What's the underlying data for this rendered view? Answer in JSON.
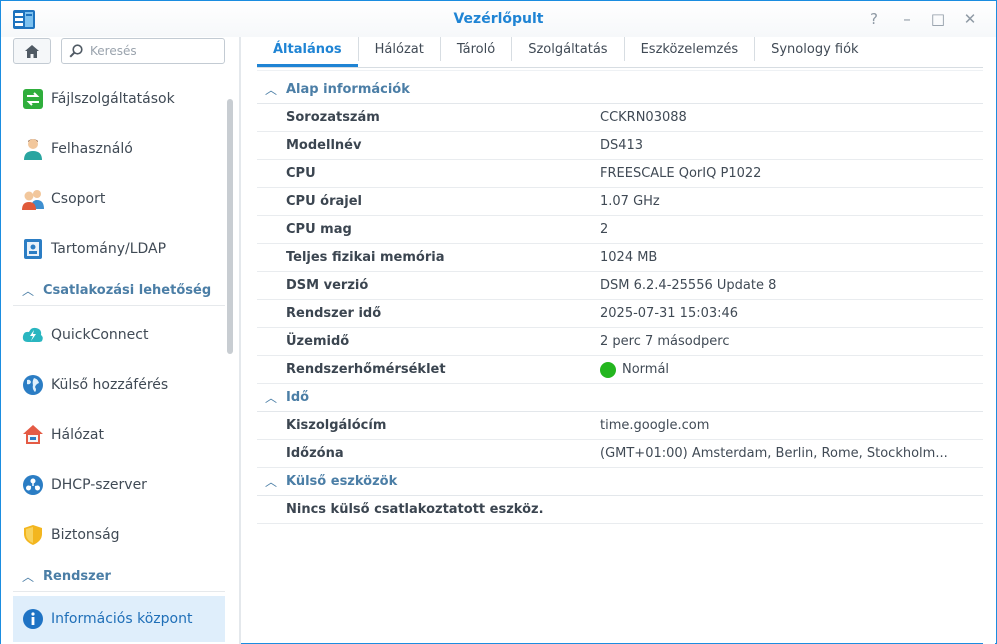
{
  "window": {
    "title": "Vezérlőpult",
    "controls": {
      "help": "?",
      "minimize": "–",
      "maximize": "□",
      "close": "✕"
    }
  },
  "search": {
    "placeholder": "Keresés",
    "value": ""
  },
  "sidebar": {
    "items_top": [
      {
        "label": "Fájlszolgáltatások",
        "icon": "file-services-icon"
      },
      {
        "label": "Felhasználó",
        "icon": "user-icon"
      },
      {
        "label": "Csoport",
        "icon": "group-icon"
      },
      {
        "label": "Tartomány/LDAP",
        "icon": "domain-ldap-icon"
      }
    ],
    "group_connectivity": "Csatlakozási lehetőség",
    "items_connectivity": [
      {
        "label": "QuickConnect",
        "icon": "quickconnect-icon"
      },
      {
        "label": "Külső hozzáférés",
        "icon": "external-access-icon"
      },
      {
        "label": "Hálózat",
        "icon": "network-icon"
      },
      {
        "label": "DHCP-szerver",
        "icon": "dhcp-server-icon"
      },
      {
        "label": "Biztonság",
        "icon": "security-icon"
      }
    ],
    "group_system": "Rendszer",
    "items_system": [
      {
        "label": "Információs központ",
        "icon": "info-center-icon",
        "active": true
      }
    ]
  },
  "tabs": [
    "Általános",
    "Hálózat",
    "Tároló",
    "Szolgáltatás",
    "Eszközelemzés",
    "Synology fiók"
  ],
  "active_tab": "Általános",
  "sections": {
    "basic": {
      "title": "Alap információk",
      "rows": [
        {
          "key": "Sorozatszám",
          "value": "CCKRN03088"
        },
        {
          "key": "Modellnév",
          "value": "DS413"
        },
        {
          "key": "CPU",
          "value": "FREESCALE QorIQ P1022"
        },
        {
          "key": "CPU órajel",
          "value": "1.07 GHz"
        },
        {
          "key": "CPU mag",
          "value": "2"
        },
        {
          "key": "Teljes fizikai memória",
          "value": "1024 MB"
        },
        {
          "key": "DSM verzió",
          "value": "DSM 6.2.4-25556 Update 8"
        },
        {
          "key": "Rendszer idő",
          "value": "2025-07-31 15:03:46"
        },
        {
          "key": "Üzemidő",
          "value": "2 perc 7 másodperc"
        },
        {
          "key": "Rendszerhőmérséklet",
          "value": "Normál",
          "status_color": "#24b61f"
        }
      ]
    },
    "time": {
      "title": "Idő",
      "rows": [
        {
          "key": "Kiszolgálócím",
          "value": "time.google.com"
        },
        {
          "key": "Időzóna",
          "value": "(GMT+01:00) Amsterdam, Berlin, Rome, Stockholm..."
        }
      ]
    },
    "external": {
      "title": "Külső eszközök",
      "empty_text": "Nincs külső csatlakoztatott eszköz."
    }
  },
  "colors": {
    "accent": "#1f84d4",
    "section_title": "#4b7ea6",
    "active_bg": "#dfeefb",
    "status_ok": "#24b61f"
  }
}
